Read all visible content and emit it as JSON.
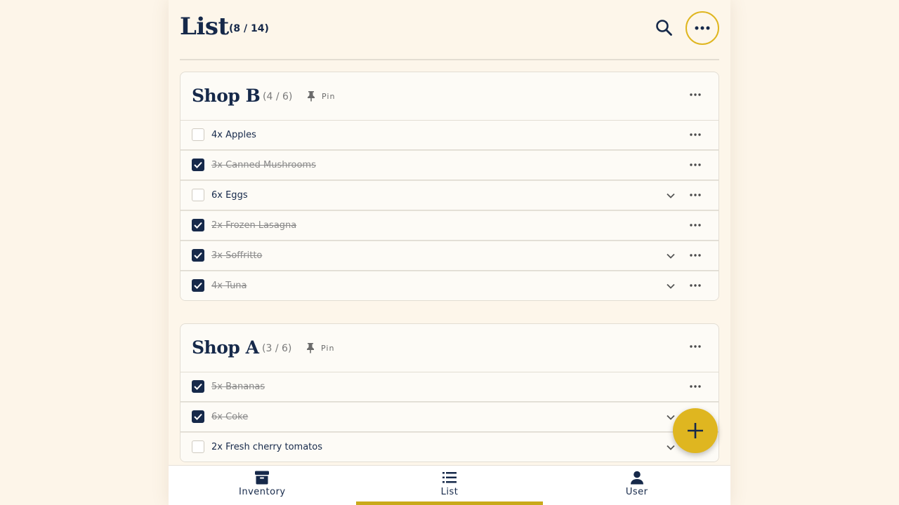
{
  "header": {
    "title": "List",
    "count": "(8 / 14)",
    "search_icon": "search-icon",
    "more_icon": "more-horizontal-icon"
  },
  "pin_label": "Pin",
  "colors": {
    "background": "#fdf6ea",
    "navy": "#16294a",
    "accent": "#dfb620",
    "muted": "#8a8a8a"
  },
  "shops": [
    {
      "name": "Shop B",
      "count": "(4 / 6)",
      "items": [
        {
          "label": "4x Apples",
          "checked": false,
          "expandable": false
        },
        {
          "label": "3x Canned Mushrooms",
          "checked": true,
          "expandable": false
        },
        {
          "label": "6x Eggs",
          "checked": false,
          "expandable": true
        },
        {
          "label": "2x Frozen Lasagna",
          "checked": true,
          "expandable": false
        },
        {
          "label": "3x Soffritto",
          "checked": true,
          "expandable": true
        },
        {
          "label": "4x Tuna",
          "checked": true,
          "expandable": true
        }
      ]
    },
    {
      "name": "Shop A",
      "count": "(3 / 6)",
      "items": [
        {
          "label": "5x Bananas",
          "checked": true,
          "expandable": false
        },
        {
          "label": "6x Coke",
          "checked": true,
          "expandable": true
        },
        {
          "label": "2x Fresh cherry tomatos",
          "checked": false,
          "expandable": true
        }
      ]
    }
  ],
  "fab_icon": "plus-icon",
  "nav": [
    {
      "label": "Inventory",
      "icon": "archive-icon",
      "active": false
    },
    {
      "label": "List",
      "icon": "list-icon",
      "active": true
    },
    {
      "label": "User",
      "icon": "user-icon",
      "active": false
    }
  ]
}
